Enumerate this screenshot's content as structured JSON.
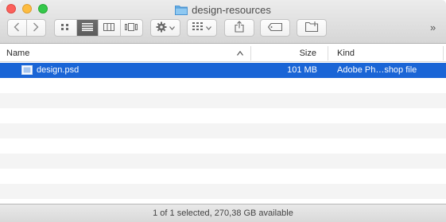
{
  "window": {
    "title": "design-resources"
  },
  "toolbar": {
    "back_icon": "chevron-left-icon",
    "forward_icon": "chevron-right-icon",
    "view_icons": [
      "icon-view-icon",
      "list-view-icon",
      "column-view-icon",
      "cover-flow-icon"
    ],
    "active_view": "list-view-icon",
    "action_icon": "gear-icon",
    "arrange_icon": "arrange-grid-icon",
    "share_icon": "share-icon",
    "tag_icon": "tag-icon",
    "new_folder_icon": "new-folder-icon",
    "overflow": "»"
  },
  "columns": {
    "name": "Name",
    "size": "Size",
    "kind": "Kind"
  },
  "files": [
    {
      "name": "design.psd",
      "size": "101 MB",
      "kind": "Adobe Ph…shop file",
      "selected": true
    }
  ],
  "status": {
    "text": "1 of 1 selected, 270,38 GB available"
  },
  "colors": {
    "selection": "#1a65d6",
    "folder": "#6bb3e8"
  }
}
